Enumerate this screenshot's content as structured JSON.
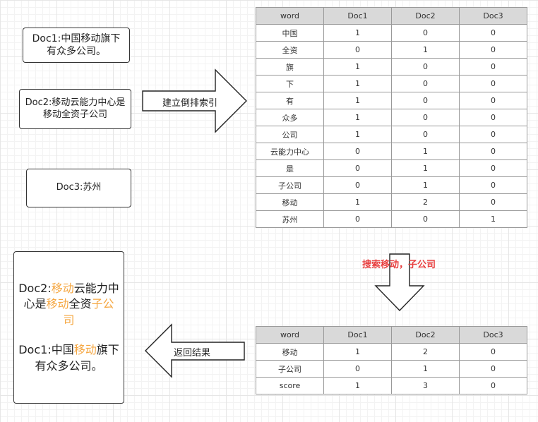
{
  "boxes": {
    "doc1": "Doc1:中国移动旗下有众多公司。",
    "doc2": "Doc2:移动云能力中心是移动全资子公司",
    "doc3": "Doc3:苏州"
  },
  "arrows": {
    "build_index": "建立倒排索引",
    "search": "搜索移动，子公司",
    "return_result": "返回结果"
  },
  "table1": {
    "headers": [
      "word",
      "Doc1",
      "Doc2",
      "Doc3"
    ],
    "rows": [
      [
        "中国",
        "1",
        "0",
        "0"
      ],
      [
        "全资",
        "0",
        "1",
        "0"
      ],
      [
        "旗",
        "1",
        "0",
        "0"
      ],
      [
        "下",
        "1",
        "0",
        "0"
      ],
      [
        "有",
        "1",
        "0",
        "0"
      ],
      [
        "众多",
        "1",
        "0",
        "0"
      ],
      [
        "公司",
        "1",
        "0",
        "0"
      ],
      [
        "云能力中心",
        "0",
        "1",
        "0"
      ],
      [
        "是",
        "0",
        "1",
        "0"
      ],
      [
        "子公司",
        "0",
        "1",
        "0"
      ],
      [
        "移动",
        "1",
        "2",
        "0"
      ],
      [
        "苏州",
        "0",
        "0",
        "1"
      ]
    ]
  },
  "table2": {
    "headers": [
      "word",
      "Doc1",
      "Doc2",
      "Doc3"
    ],
    "rows": [
      [
        "移动",
        "1",
        "2",
        "0"
      ],
      [
        "子公司",
        "0",
        "1",
        "0"
      ],
      [
        "score",
        "1",
        "3",
        "0"
      ]
    ]
  },
  "result": {
    "r1_a": "Doc2:",
    "r1_b": "移动",
    "r1_c": "云能力中心是",
    "r1_d": "移动",
    "r1_e": "全资",
    "r1_f": "子公司",
    "r2_a": "Doc1:中国",
    "r2_b": "移动",
    "r2_c": "旗下有众多公司。"
  },
  "colors": {
    "highlight": "#f5a742",
    "search_label": "#e84040"
  }
}
